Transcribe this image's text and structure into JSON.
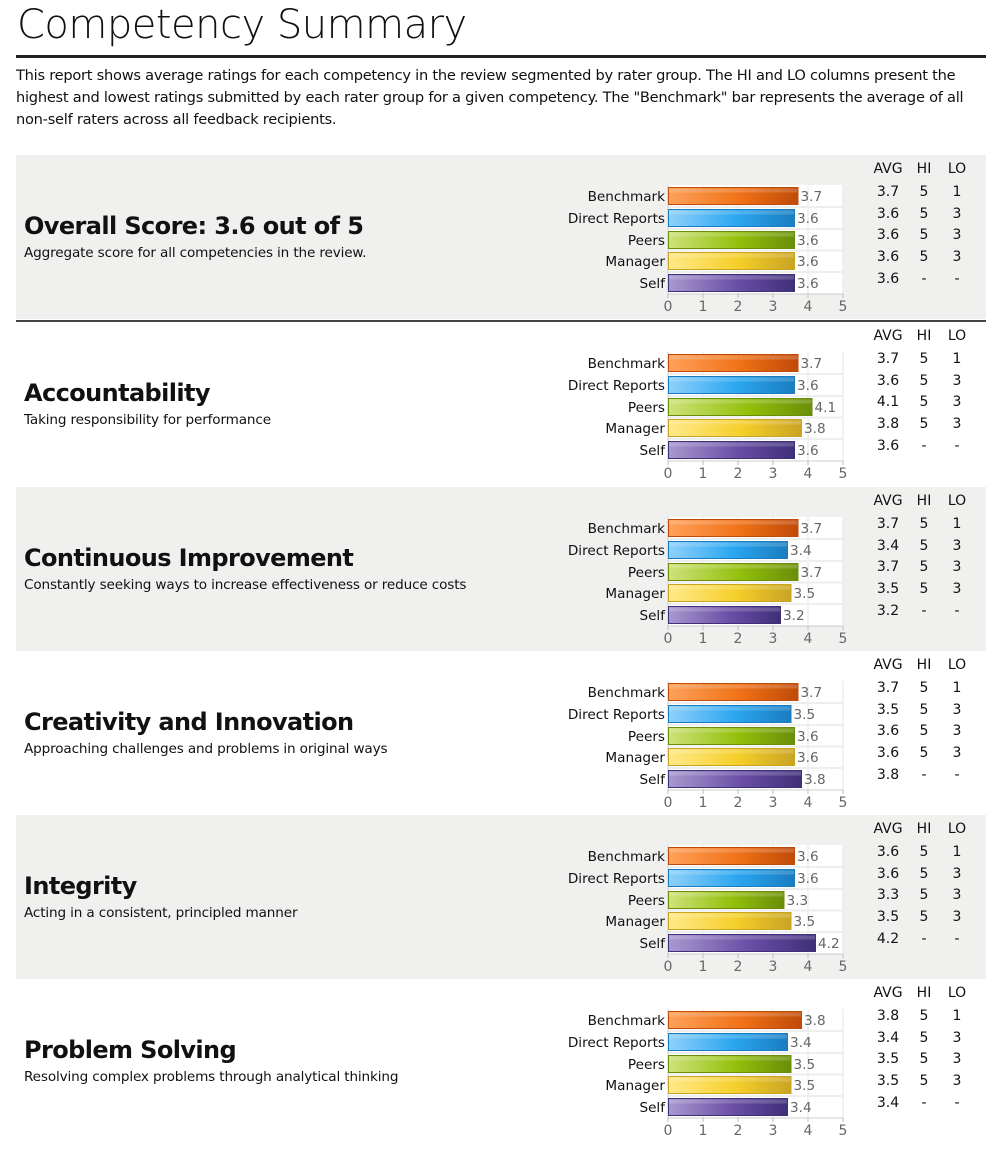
{
  "page": {
    "title": "Competency Summary",
    "intro": "This report shows average ratings for each competency in the review segmented by rater group. The HI and LO columns present the highest and lowest ratings submitted by each rater group for a given competency. The \"Benchmark\" bar represents the average of all non-self raters across all feedback recipients."
  },
  "table_headers": {
    "avg": "AVG",
    "hi": "HI",
    "lo": "LO"
  },
  "colors": {
    "Benchmark": [
      "#ffa15a",
      "#f07218",
      "#c04a08"
    ],
    "Direct Reports": [
      "#8fd0fb",
      "#2aa6f0",
      "#1a7cc0"
    ],
    "Peers": [
      "#cfe27a",
      "#93c00c",
      "#6a8e08"
    ],
    "Manager": [
      "#ffe98a",
      "#f5cf2a",
      "#c9a423"
    ],
    "Self": [
      "#a898cf",
      "#6a4ea6",
      "#3f2f78"
    ]
  },
  "sections": [
    {
      "heading": "Overall Score: 3.6 out of 5",
      "description": "Aggregate score for all competencies in the review.",
      "rows": [
        {
          "group": "Benchmark",
          "value": 3.7,
          "avg": "3.7",
          "hi": "5",
          "lo": "1"
        },
        {
          "group": "Direct Reports",
          "value": 3.6,
          "avg": "3.6",
          "hi": "5",
          "lo": "3"
        },
        {
          "group": "Peers",
          "value": 3.6,
          "avg": "3.6",
          "hi": "5",
          "lo": "3"
        },
        {
          "group": "Manager",
          "value": 3.6,
          "avg": "3.6",
          "hi": "5",
          "lo": "3"
        },
        {
          "group": "Self",
          "value": 3.6,
          "avg": "3.6",
          "hi": "-",
          "lo": "-"
        }
      ]
    },
    {
      "heading": "Accountability",
      "description": "Taking responsibility for performance",
      "rows": [
        {
          "group": "Benchmark",
          "value": 3.7,
          "avg": "3.7",
          "hi": "5",
          "lo": "1"
        },
        {
          "group": "Direct Reports",
          "value": 3.6,
          "avg": "3.6",
          "hi": "5",
          "lo": "3"
        },
        {
          "group": "Peers",
          "value": 4.1,
          "avg": "4.1",
          "hi": "5",
          "lo": "3"
        },
        {
          "group": "Manager",
          "value": 3.8,
          "avg": "3.8",
          "hi": "5",
          "lo": "3"
        },
        {
          "group": "Self",
          "value": 3.6,
          "avg": "3.6",
          "hi": "-",
          "lo": "-"
        }
      ]
    },
    {
      "heading": "Continuous Improvement",
      "description": "Constantly seeking ways to increase effectiveness or reduce costs",
      "rows": [
        {
          "group": "Benchmark",
          "value": 3.7,
          "avg": "3.7",
          "hi": "5",
          "lo": "1"
        },
        {
          "group": "Direct Reports",
          "value": 3.4,
          "avg": "3.4",
          "hi": "5",
          "lo": "3"
        },
        {
          "group": "Peers",
          "value": 3.7,
          "avg": "3.7",
          "hi": "5",
          "lo": "3"
        },
        {
          "group": "Manager",
          "value": 3.5,
          "avg": "3.5",
          "hi": "5",
          "lo": "3"
        },
        {
          "group": "Self",
          "value": 3.2,
          "avg": "3.2",
          "hi": "-",
          "lo": "-"
        }
      ]
    },
    {
      "heading": "Creativity and Innovation",
      "description": "Approaching challenges and problems in original ways",
      "rows": [
        {
          "group": "Benchmark",
          "value": 3.7,
          "avg": "3.7",
          "hi": "5",
          "lo": "1"
        },
        {
          "group": "Direct Reports",
          "value": 3.5,
          "avg": "3.5",
          "hi": "5",
          "lo": "3"
        },
        {
          "group": "Peers",
          "value": 3.6,
          "avg": "3.6",
          "hi": "5",
          "lo": "3"
        },
        {
          "group": "Manager",
          "value": 3.6,
          "avg": "3.6",
          "hi": "5",
          "lo": "3"
        },
        {
          "group": "Self",
          "value": 3.8,
          "avg": "3.8",
          "hi": "-",
          "lo": "-"
        }
      ]
    },
    {
      "heading": "Integrity",
      "description": "Acting in a consistent, principled manner",
      "rows": [
        {
          "group": "Benchmark",
          "value": 3.6,
          "avg": "3.6",
          "hi": "5",
          "lo": "1"
        },
        {
          "group": "Direct Reports",
          "value": 3.6,
          "avg": "3.6",
          "hi": "5",
          "lo": "3"
        },
        {
          "group": "Peers",
          "value": 3.3,
          "avg": "3.3",
          "hi": "5",
          "lo": "3"
        },
        {
          "group": "Manager",
          "value": 3.5,
          "avg": "3.5",
          "hi": "5",
          "lo": "3"
        },
        {
          "group": "Self",
          "value": 4.2,
          "avg": "4.2",
          "hi": "-",
          "lo": "-"
        }
      ]
    },
    {
      "heading": "Problem Solving",
      "description": "Resolving complex problems through analytical thinking",
      "rows": [
        {
          "group": "Benchmark",
          "value": 3.8,
          "avg": "3.8",
          "hi": "5",
          "lo": "1"
        },
        {
          "group": "Direct Reports",
          "value": 3.4,
          "avg": "3.4",
          "hi": "5",
          "lo": "3"
        },
        {
          "group": "Peers",
          "value": 3.5,
          "avg": "3.5",
          "hi": "5",
          "lo": "3"
        },
        {
          "group": "Manager",
          "value": 3.5,
          "avg": "3.5",
          "hi": "5",
          "lo": "3"
        },
        {
          "group": "Self",
          "value": 3.4,
          "avg": "3.4",
          "hi": "-",
          "lo": "-"
        }
      ]
    }
  ],
  "chart_data": [
    {
      "type": "bar",
      "orientation": "horizontal",
      "title": "Overall Score: 3.6 out of 5",
      "categories": [
        "Benchmark",
        "Direct Reports",
        "Peers",
        "Manager",
        "Self"
      ],
      "values": [
        3.7,
        3.6,
        3.6,
        3.6,
        3.6
      ],
      "xlim": [
        0,
        5
      ],
      "xticks": [
        0,
        1,
        2,
        3,
        4,
        5
      ],
      "grid": true,
      "data_labels": true
    },
    {
      "type": "bar",
      "orientation": "horizontal",
      "title": "Accountability",
      "categories": [
        "Benchmark",
        "Direct Reports",
        "Peers",
        "Manager",
        "Self"
      ],
      "values": [
        3.7,
        3.6,
        4.1,
        3.8,
        3.6
      ],
      "xlim": [
        0,
        5
      ],
      "xticks": [
        0,
        1,
        2,
        3,
        4,
        5
      ],
      "grid": true,
      "data_labels": true
    },
    {
      "type": "bar",
      "orientation": "horizontal",
      "title": "Continuous Improvement",
      "categories": [
        "Benchmark",
        "Direct Reports",
        "Peers",
        "Manager",
        "Self"
      ],
      "values": [
        3.7,
        3.4,
        3.7,
        3.5,
        3.2
      ],
      "xlim": [
        0,
        5
      ],
      "xticks": [
        0,
        1,
        2,
        3,
        4,
        5
      ],
      "grid": true,
      "data_labels": true
    },
    {
      "type": "bar",
      "orientation": "horizontal",
      "title": "Creativity and Innovation",
      "categories": [
        "Benchmark",
        "Direct Reports",
        "Peers",
        "Manager",
        "Self"
      ],
      "values": [
        3.7,
        3.5,
        3.6,
        3.6,
        3.8
      ],
      "xlim": [
        0,
        5
      ],
      "xticks": [
        0,
        1,
        2,
        3,
        4,
        5
      ],
      "grid": true,
      "data_labels": true
    },
    {
      "type": "bar",
      "orientation": "horizontal",
      "title": "Integrity",
      "categories": [
        "Benchmark",
        "Direct Reports",
        "Peers",
        "Manager",
        "Self"
      ],
      "values": [
        3.6,
        3.6,
        3.3,
        3.5,
        4.2
      ],
      "xlim": [
        0,
        5
      ],
      "xticks": [
        0,
        1,
        2,
        3,
        4,
        5
      ],
      "grid": true,
      "data_labels": true
    },
    {
      "type": "bar",
      "orientation": "horizontal",
      "title": "Problem Solving",
      "categories": [
        "Benchmark",
        "Direct Reports",
        "Peers",
        "Manager",
        "Self"
      ],
      "values": [
        3.8,
        3.4,
        3.5,
        3.5,
        3.4
      ],
      "xlim": [
        0,
        5
      ],
      "xticks": [
        0,
        1,
        2,
        3,
        4,
        5
      ],
      "grid": true,
      "data_labels": true
    }
  ]
}
